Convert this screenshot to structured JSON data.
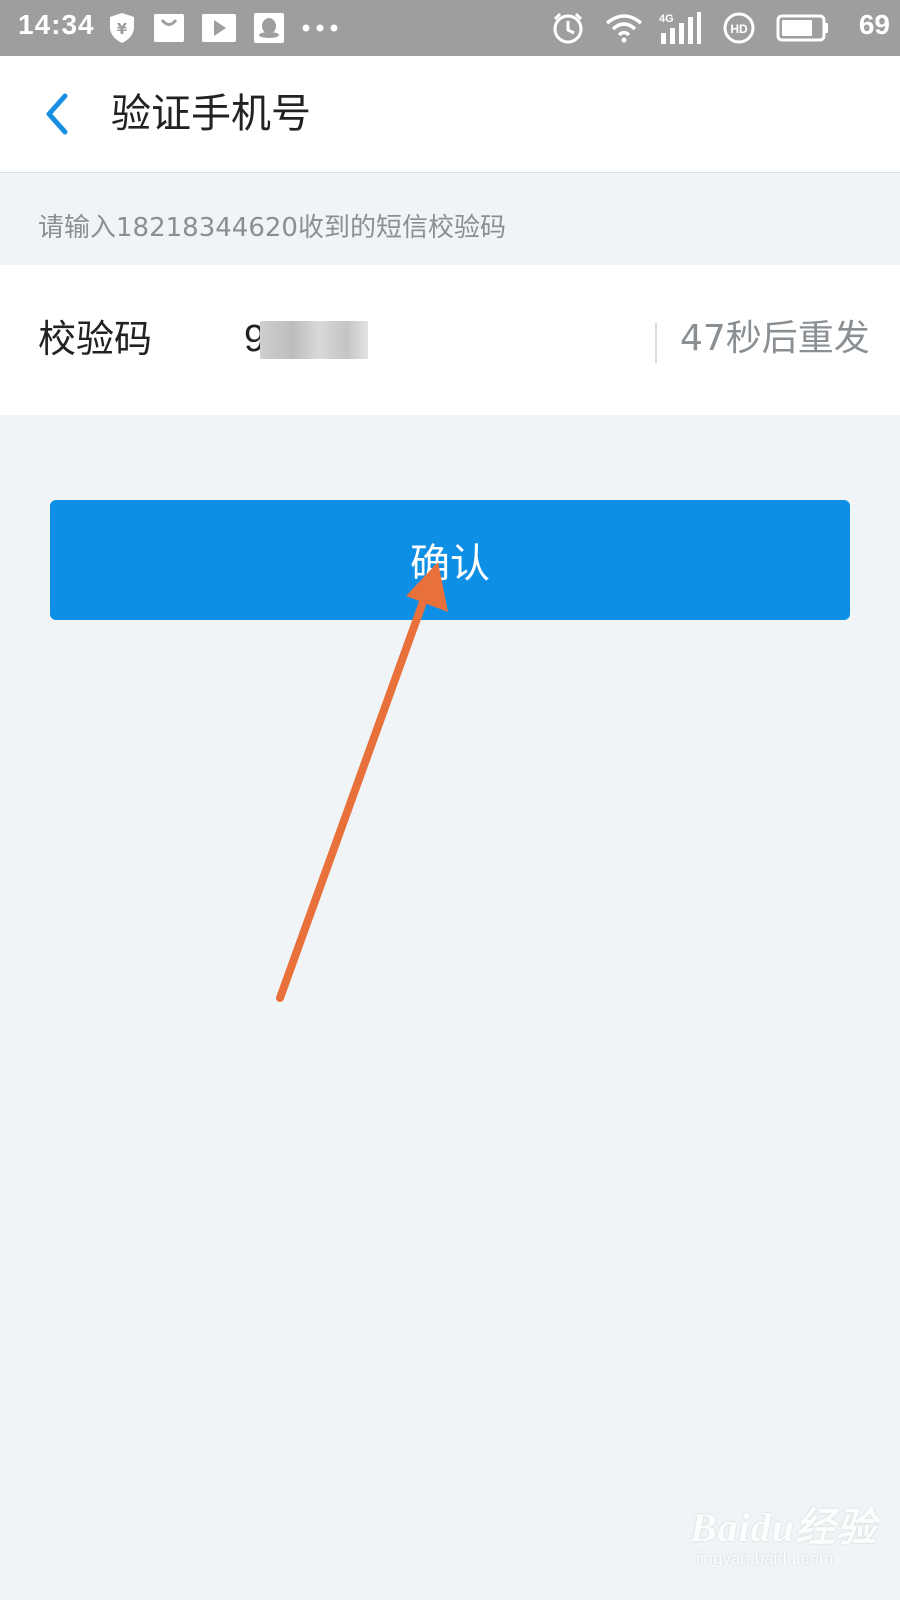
{
  "status_bar": {
    "time": "14:34",
    "battery_level": "69",
    "icons": [
      "shield-yuan-icon",
      "bag-icon",
      "play-icon",
      "qq-icon",
      "more-dots-icon",
      "alarm-icon",
      "wifi-icon",
      "signal-4g-icon",
      "hd-icon",
      "battery-icon"
    ]
  },
  "header": {
    "title": "验证手机号",
    "back_icon": "chevron-left-icon"
  },
  "form": {
    "hint": "请输入18218344620收到的短信校验码",
    "code_label": "校验码",
    "code_value": "9      5",
    "resend_label": "47秒后重发"
  },
  "confirm_button": {
    "label": "确认"
  },
  "colors": {
    "primary": "#0e8fe6",
    "status_bar": "#9e9e9e",
    "page_background": "#f0f4f7",
    "annotation_arrow": "#e8703a"
  },
  "watermark": {
    "brand": "Baidu经验",
    "url": "jingyan.baidu.com"
  }
}
